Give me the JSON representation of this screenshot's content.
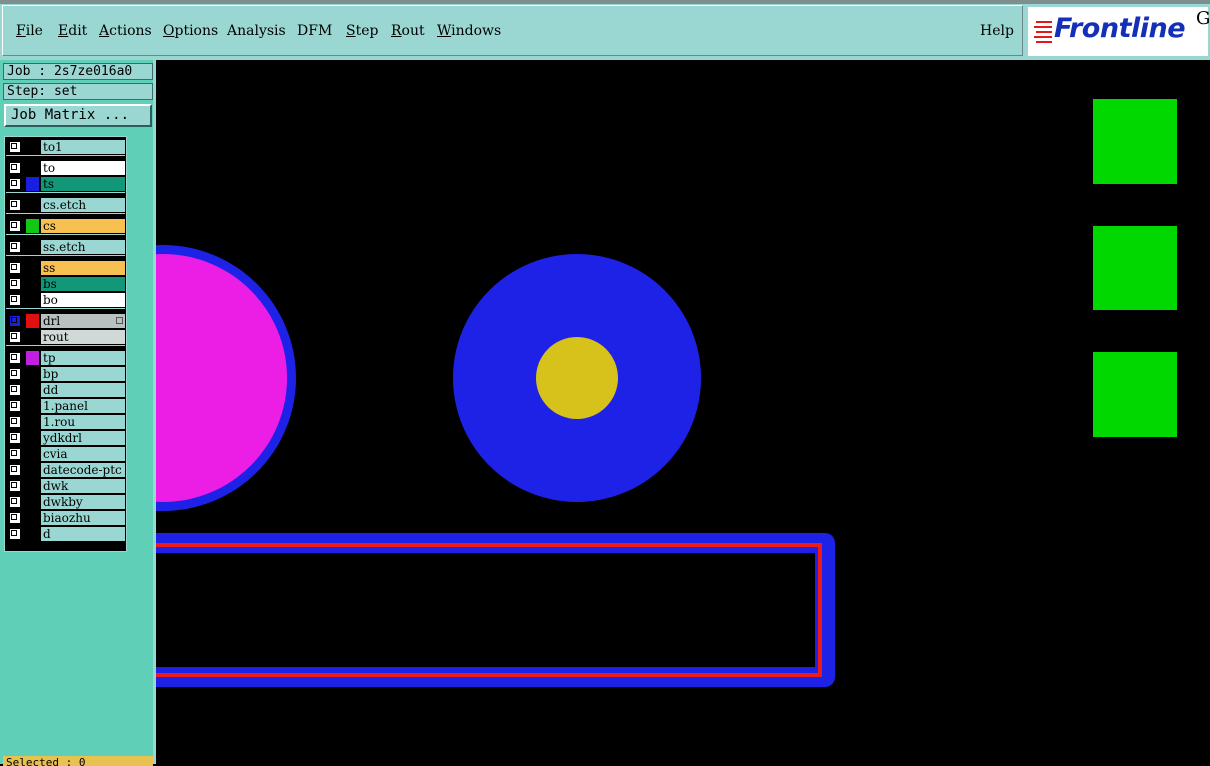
{
  "menu": {
    "items": [
      "File",
      "Edit",
      "Actions",
      "Options",
      "Analysis",
      "DFM",
      "Step",
      "Rout",
      "Windows"
    ],
    "help": "Help"
  },
  "logo": {
    "text": "Frontline",
    "suffix": "G"
  },
  "job": {
    "job_label": "Job : 2s7ze016a0",
    "step_label": "Step: set",
    "matrix_button": "Job Matrix ..."
  },
  "layers": [
    {
      "name": "to1",
      "color": "#9ad7d3",
      "swatch": "#000000"
    },
    {
      "name": "to",
      "color": "#ffffff",
      "swatch": "#000000"
    },
    {
      "name": "ts",
      "color": "#129878",
      "swatch": "#1a1ee0"
    },
    {
      "name": "cs.etch",
      "color": "#9ad7d3",
      "swatch": "#000000"
    },
    {
      "name": "cs",
      "color": "#f8c050",
      "swatch": "#12c812"
    },
    {
      "name": "ss.etch",
      "color": "#9ad7d3",
      "swatch": "#000000"
    },
    {
      "name": "ss",
      "color": "#f8c050",
      "swatch": "#000000"
    },
    {
      "name": "bs",
      "color": "#129878",
      "swatch": "#000000"
    },
    {
      "name": "bo",
      "color": "#ffffff",
      "swatch": "#000000"
    },
    {
      "name": "drl",
      "color": "#b8c0c0",
      "swatch": "#e01010"
    },
    {
      "name": "rout",
      "color": "#d0d8d8",
      "swatch": "#000000"
    },
    {
      "name": "tp",
      "color": "#9ad7d3",
      "swatch": "#c020e0"
    },
    {
      "name": "bp",
      "color": "#9ad7d3",
      "swatch": "#000000"
    },
    {
      "name": "dd",
      "color": "#9ad7d3",
      "swatch": "#000000"
    },
    {
      "name": "1.panel",
      "color": "#9ad7d3",
      "swatch": "#000000"
    },
    {
      "name": "1.rou",
      "color": "#9ad7d3",
      "swatch": "#000000"
    },
    {
      "name": "ydkdrl",
      "color": "#9ad7d3",
      "swatch": "#000000"
    },
    {
      "name": "cvia",
      "color": "#9ad7d3",
      "swatch": "#000000"
    },
    {
      "name": "datecode-ptc",
      "color": "#9ad7d3",
      "swatch": "#000000"
    },
    {
      "name": "dwk",
      "color": "#9ad7d3",
      "swatch": "#000000"
    },
    {
      "name": "dwkby",
      "color": "#9ad7d3",
      "swatch": "#000000"
    },
    {
      "name": "biaozhu",
      "color": "#9ad7d3",
      "swatch": "#000000"
    },
    {
      "name": "d",
      "color": "#9ad7d3",
      "swatch": "#000000"
    }
  ],
  "status": {
    "selected": "Selected : 0"
  },
  "colors": {
    "pad_blue": "#1e22e6",
    "pad_magenta": "#ec1ee6",
    "drill_yellow": "#d6c21a",
    "smd_green": "#00d800",
    "trace_red": "#ee1a1a"
  }
}
